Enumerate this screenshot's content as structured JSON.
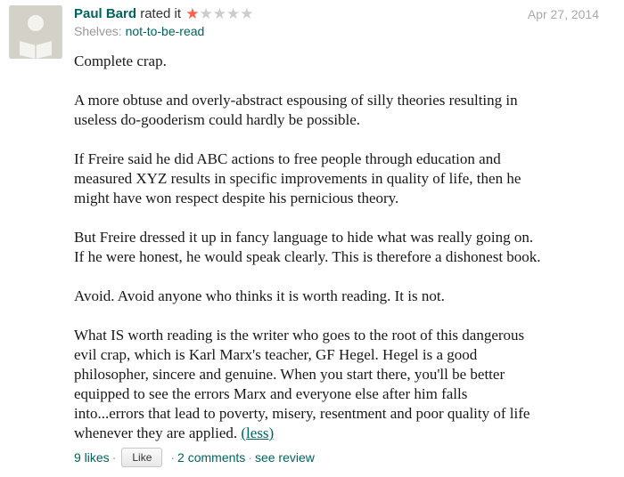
{
  "review": {
    "reviewer_name": "Paul Bard",
    "rated_text": "rated it",
    "rating": {
      "value": 1,
      "max": 5
    },
    "date": "Apr 27, 2014",
    "shelves_label": "Shelves:",
    "shelf": "not-to-be-read",
    "paragraphs": [
      [
        "Complete crap."
      ],
      [
        "A more obtuse and overly-abstract espousing of silly theories resulting in",
        "useless do-gooderism could hardly be possible."
      ],
      [
        "If Freire said he did ABC actions to free people through education and",
        "measured XYZ results in specific improvements in quality of life, then he",
        "might have won respect despite his pernicious theory."
      ],
      [
        "But Freire dressed it up in fancy language to hide what was really going on.",
        "If he were honest, he would speak clearly. This is therefore a dishonest book."
      ],
      [
        "Avoid. Avoid anyone who thinks it is worth reading. It is not."
      ],
      [
        "What IS worth reading is the writer who goes to the root of this dangerous",
        "evil crap, which is Karl Marx's teacher, GF Hegel. Hegel is a good",
        "philosopher, sincere and genuine. When you start there, you'll be better",
        "equipped to see the errors Marx and everyone else after him falls",
        "into...errors that lead to poverty, misery, resentment and poor quality of life",
        "whenever they are applied."
      ]
    ],
    "less_link": "(less)"
  },
  "footer": {
    "likes": "9 likes",
    "separator": "·",
    "like_button": "Like",
    "comments": "2 comments",
    "see_review": "see review"
  },
  "colors": {
    "link": "#00635d",
    "star_on": "#fa604a",
    "star_off": "#cccccc",
    "muted": "#999999",
    "avatar_bg": "#d3d1c8"
  },
  "icons": {
    "avatar": "default-user-avatar-icon",
    "star": "star-icon"
  }
}
